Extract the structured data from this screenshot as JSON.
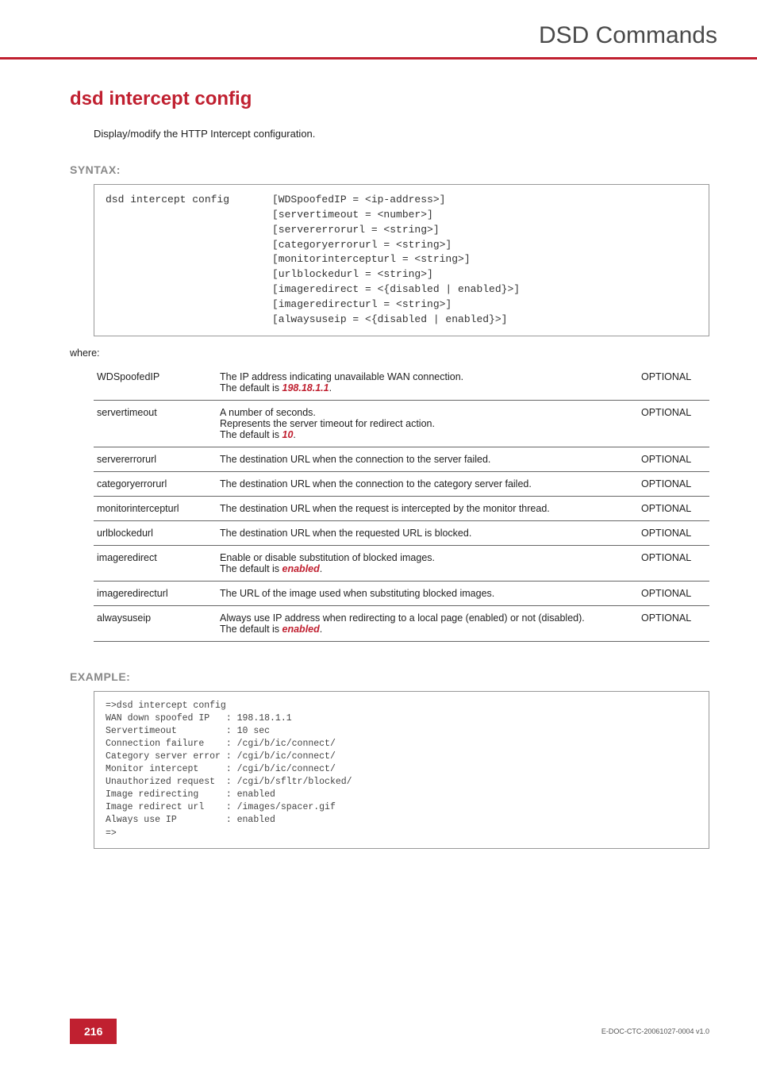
{
  "header": {
    "title": "DSD Commands"
  },
  "command": {
    "title": "dsd intercept config",
    "intro": "Display/modify the HTTP Intercept configuration."
  },
  "syntax": {
    "label": "SYNTAX:",
    "cmd": "dsd intercept config",
    "args": "[WDSpoofedIP = <ip-address>]\n[servertimeout = <number>]\n[servererrorurl = <string>]\n[categoryerrorurl = <string>]\n[monitorintercepturl = <string>]\n[urlblockedurl = <string>]\n[imageredirect = <{disabled | enabled}>]\n[imageredirecturl = <string>]\n[alwaysuseip = <{disabled | enabled}>]"
  },
  "where_label": "where:",
  "params": [
    {
      "name": "WDSpoofedIP",
      "desc_pre": "The IP address indicating unavailable WAN connection.\nThe default is ",
      "emph": "198.18.1.1",
      "desc_post": ".",
      "opt": "OPTIONAL"
    },
    {
      "name": "servertimeout",
      "desc_pre": "A number of seconds.\nRepresents the server timeout for redirect action.\nThe default is ",
      "emph": "10",
      "desc_post": ".",
      "opt": "OPTIONAL"
    },
    {
      "name": "servererrorurl",
      "desc_plain": "The destination URL when the connection to the server failed.",
      "opt": "OPTIONAL"
    },
    {
      "name": "categoryerrorurl",
      "desc_plain": "The destination URL when the connection to the category server failed.",
      "opt": "OPTIONAL"
    },
    {
      "name": "monitorintercepturl",
      "desc_plain": "The destination URL when the request is intercepted by the monitor thread.",
      "opt": "OPTIONAL"
    },
    {
      "name": "urlblockedurl",
      "desc_plain": "The destination URL when the requested URL is blocked.",
      "opt": "OPTIONAL"
    },
    {
      "name": "imageredirect",
      "desc_pre": "Enable or disable substitution of blocked images.\nThe default is ",
      "emph": "enabled",
      "desc_post": ".",
      "opt": "OPTIONAL"
    },
    {
      "name": "imageredirecturl",
      "desc_plain": "The URL of the image used when substituting blocked images.",
      "opt": "OPTIONAL"
    },
    {
      "name": "alwaysuseip",
      "desc_pre": "Always use IP address when redirecting to a local page (enabled) or not (disabled).\nThe default is ",
      "emph": "enabled",
      "desc_post": ".",
      "opt": "OPTIONAL"
    }
  ],
  "example": {
    "label": "EXAMPLE:",
    "text": "=>dsd intercept config\nWAN down spoofed IP   : 198.18.1.1\nServertimeout         : 10 sec\nConnection failure    : /cgi/b/ic/connect/\nCategory server error : /cgi/b/ic/connect/\nMonitor intercept     : /cgi/b/ic/connect/\nUnauthorized request  : /cgi/b/sfltr/blocked/\nImage redirecting     : enabled\nImage redirect url    : /images/spacer.gif\nAlways use IP         : enabled\n=>"
  },
  "footer": {
    "page": "216",
    "docid": "E-DOC-CTC-20061027-0004 v1.0"
  }
}
